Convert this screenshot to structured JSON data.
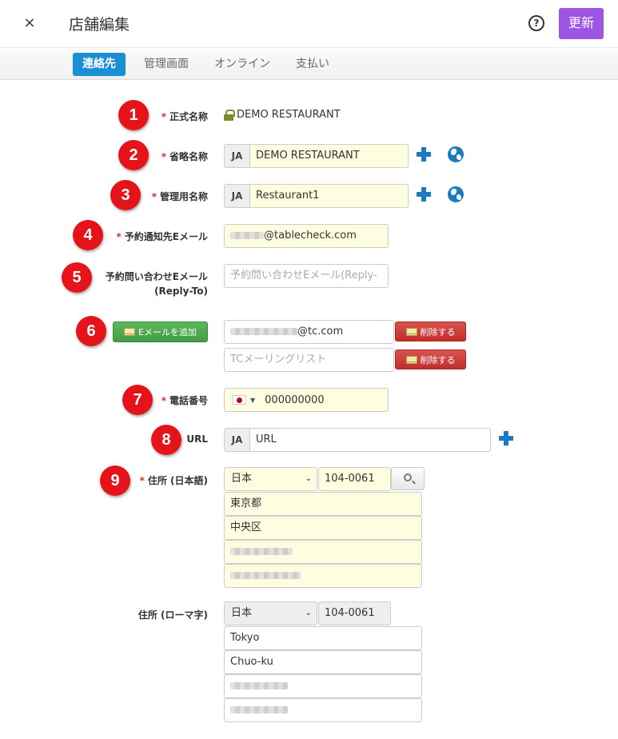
{
  "header": {
    "close_label": "×",
    "title": "店舗編集",
    "help_label": "?",
    "update_label": "更新"
  },
  "tabs": [
    {
      "label": "連絡先",
      "active": true
    },
    {
      "label": "管理画面",
      "active": false
    },
    {
      "label": "オンライン",
      "active": false
    },
    {
      "label": "支払い",
      "active": false
    }
  ],
  "badges": [
    "1",
    "2",
    "3",
    "4",
    "5",
    "6",
    "7",
    "8",
    "9"
  ],
  "form": {
    "required_mark": "*",
    "official_name": {
      "label": "正式名称",
      "value": "DEMO RESTAURANT"
    },
    "short_name": {
      "label": "省略名称",
      "lang": "JA",
      "value": "DEMO RESTAURANT"
    },
    "admin_name": {
      "label": "管理用名称",
      "lang": "JA",
      "value": "Restaurant1"
    },
    "notify_email": {
      "label": "予約通知先Eメール",
      "value_suffix": "@tablecheck.com"
    },
    "inquiry_email": {
      "label_line1": "予約問い合わせEメール",
      "label_line2": "(Reply-To)",
      "placeholder": "予約問い合わせEメール(Reply-"
    },
    "email_list": {
      "add_button": "Eメールを追加",
      "items": [
        {
          "value_suffix": "@tc.com",
          "delete_label": "削除する"
        },
        {
          "placeholder": "TCメーリングリスト",
          "delete_label": "削除する"
        }
      ]
    },
    "phone": {
      "label": "電話番号",
      "value": "000000000"
    },
    "url": {
      "label": "URL",
      "lang": "JA",
      "placeholder": "URL"
    },
    "address_ja": {
      "label": "住所 (日本語)",
      "country": "日本",
      "postal": "104-0061",
      "prefecture": "東京都",
      "city": "中央区"
    },
    "address_roman": {
      "label": "住所 (ローマ字)",
      "country": "日本",
      "postal": "104-0061",
      "prefecture": "Tokyo",
      "city": "Chuo-ku"
    }
  },
  "colors": {
    "accent": "#9d55e4",
    "tab_active": "#1a8fd6",
    "badge": "#e5141b",
    "input_bg": "#fffde0"
  }
}
